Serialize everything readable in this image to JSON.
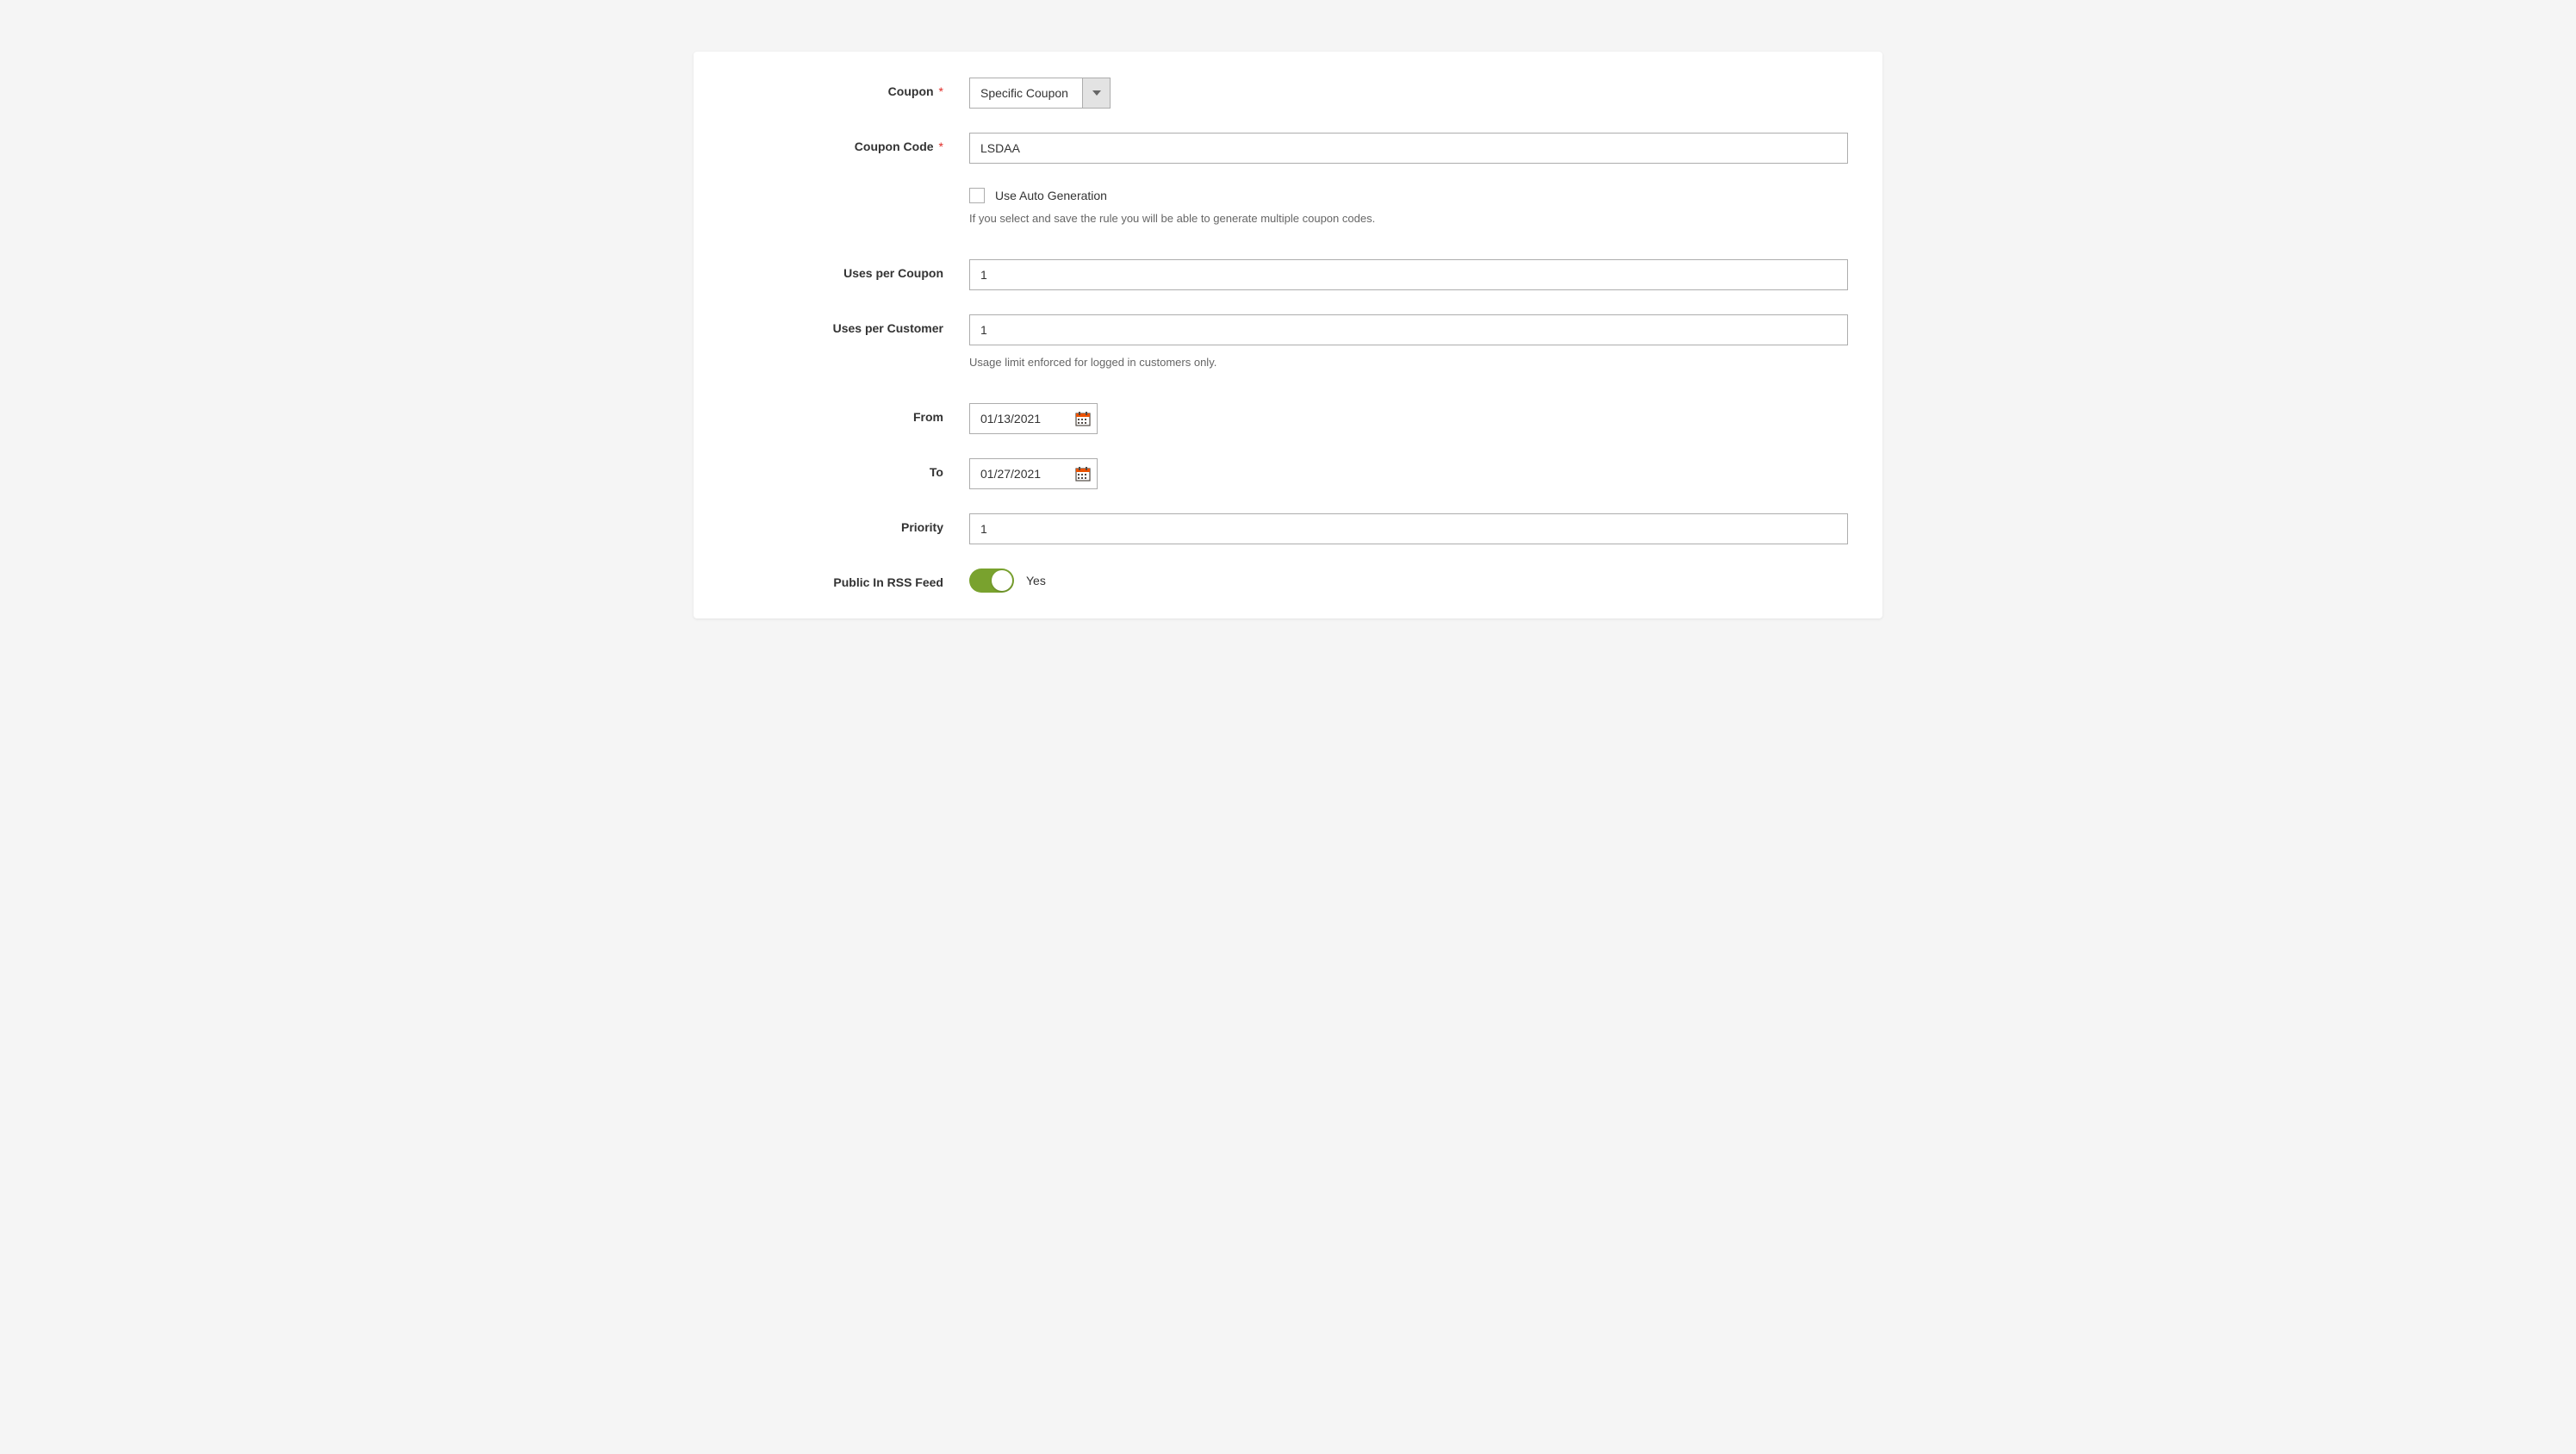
{
  "coupon": {
    "label": "Coupon",
    "required": "*",
    "value": "Specific Coupon"
  },
  "coupon_code": {
    "label": "Coupon Code",
    "required": "*",
    "value": "LSDAA"
  },
  "auto_generation": {
    "label": "Use Auto Generation",
    "help": "If you select and save the rule you will be able to generate multiple coupon codes."
  },
  "uses_per_coupon": {
    "label": "Uses per Coupon",
    "value": "1"
  },
  "uses_per_customer": {
    "label": "Uses per Customer",
    "value": "1",
    "help": "Usage limit enforced for logged in customers only."
  },
  "from": {
    "label": "From",
    "value": "01/13/2021"
  },
  "to": {
    "label": "To",
    "value": "01/27/2021"
  },
  "priority": {
    "label": "Priority",
    "value": "1"
  },
  "rss": {
    "label": "Public In RSS Feed",
    "value": "Yes"
  }
}
